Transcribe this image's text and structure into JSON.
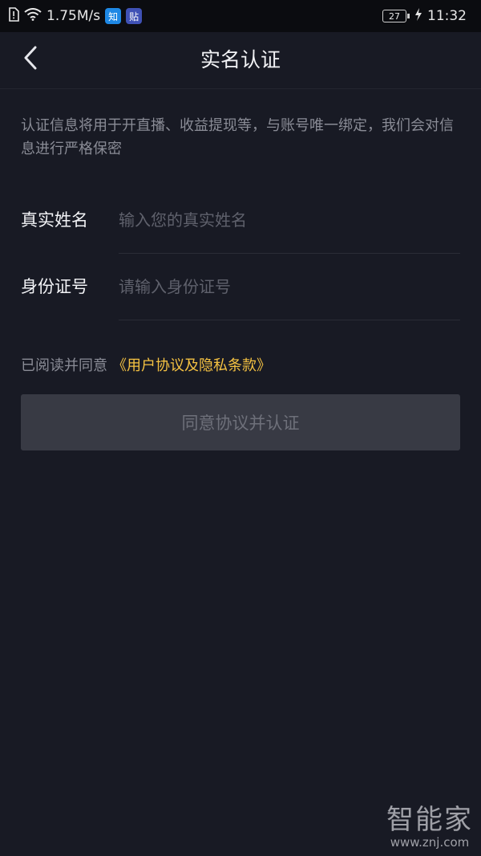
{
  "status_bar": {
    "network_speed": "1.75M/s",
    "app_badges": [
      {
        "icon": "zhihu-icon",
        "text": "知",
        "color": "#1E88E5"
      },
      {
        "icon": "tieba-icon",
        "text": "贴",
        "color": "#3F51B5"
      }
    ],
    "battery": "27",
    "time": "11:32"
  },
  "header": {
    "title": "实名认证"
  },
  "notice": "认证信息将用于开直播、收益提现等，与账号唯一绑定，我们会对信息进行严格保密",
  "form": {
    "name": {
      "label": "真实姓名",
      "placeholder": "输入您的真实姓名",
      "value": ""
    },
    "id_number": {
      "label": "身份证号",
      "placeholder": "请输入身份证号",
      "value": ""
    }
  },
  "agreement": {
    "prefix": "已阅读并同意",
    "link": "《用户协议及隐私条款》"
  },
  "submit_label": "同意协议并认证",
  "watermark": {
    "logo": "智能家",
    "url": "www.znj.com"
  },
  "colors": {
    "background": "#181A24",
    "accent": "#F5C242",
    "button_disabled": "#383A44"
  }
}
